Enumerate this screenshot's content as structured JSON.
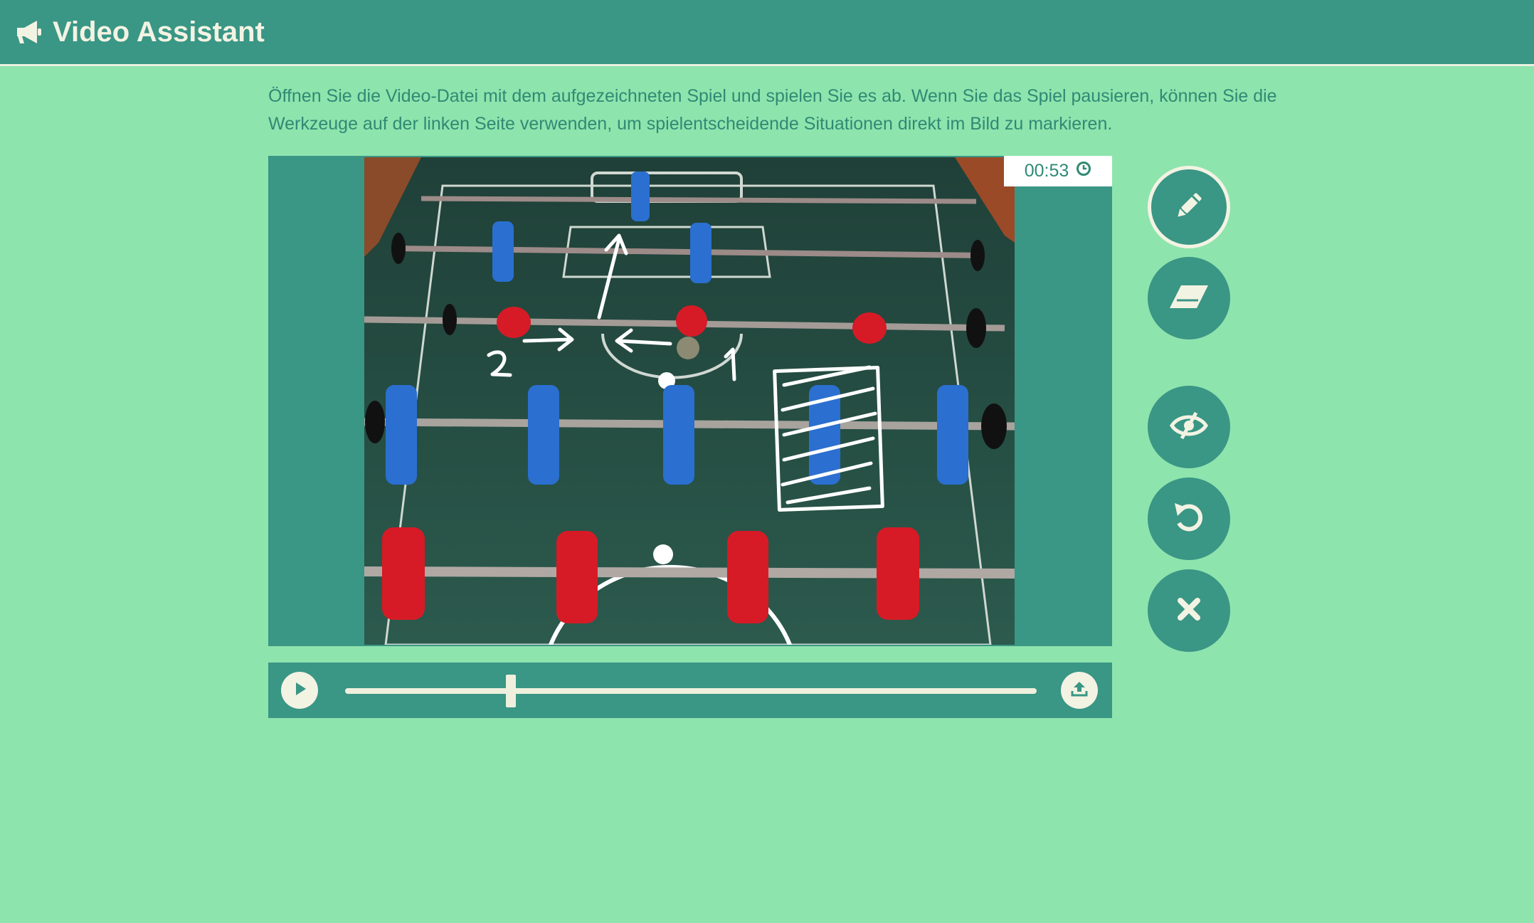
{
  "app": {
    "title": "Video Assistant",
    "icon": "megaphone-icon"
  },
  "intro_text": "Öffnen Sie die Video-Datei mit dem aufgezeichneten Spiel und spielen Sie es ab. Wenn Sie das Spiel pausieren, können Sie die Werkzeuge auf der linken Seite verwenden, um spielentscheidende Situationen direkt im Bild zu markieren.",
  "video": {
    "timestamp": "00:53",
    "annotations": [
      "2",
      "1"
    ],
    "playback_progress": 0.24
  },
  "controls": {
    "play_icon": "play-icon",
    "upload_icon": "upload-icon"
  },
  "tools": [
    {
      "name": "pencil",
      "icon": "pencil-icon",
      "active": true
    },
    {
      "name": "eraser",
      "icon": "eraser-icon",
      "active": false
    },
    {
      "name": "hide",
      "icon": "eye-slash-icon",
      "active": false
    },
    {
      "name": "undo",
      "icon": "undo-icon",
      "active": false
    },
    {
      "name": "close",
      "icon": "close-icon",
      "active": false
    }
  ],
  "colors": {
    "background": "#8ee4ad",
    "primary": "#3a9685",
    "light": "#f3f3e3",
    "text": "#2f8a74"
  }
}
